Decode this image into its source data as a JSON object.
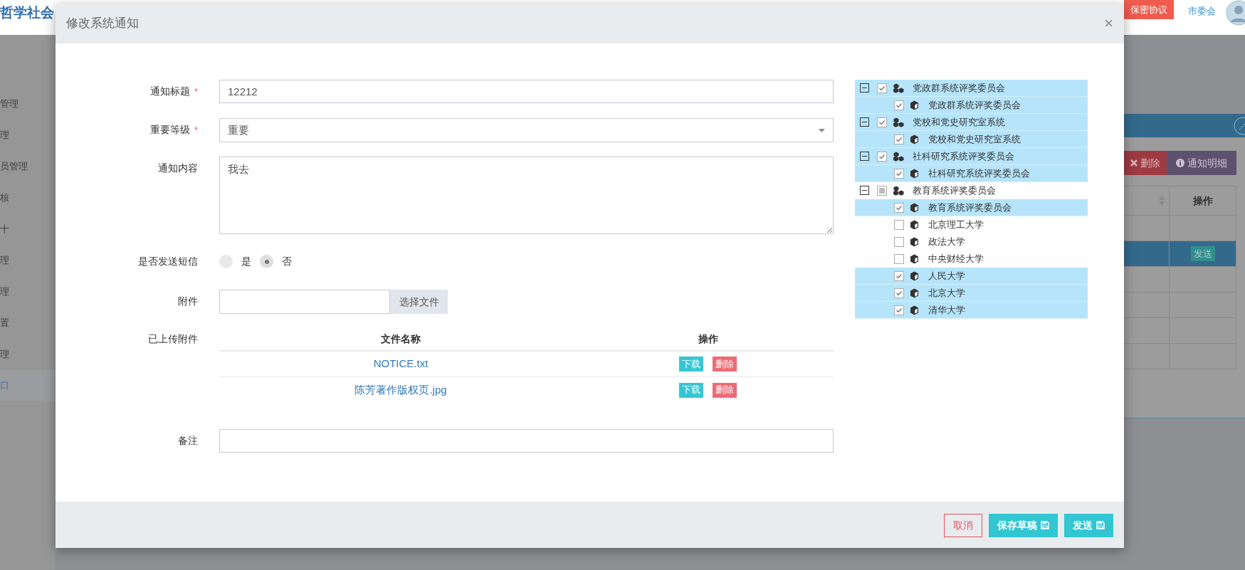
{
  "header": {
    "title": "哲学社会",
    "agreement_button": "保密协议",
    "user": "市委会"
  },
  "sidebar": {
    "items": [
      {
        "label": "管理",
        "selected": false
      },
      {
        "label": "理",
        "selected": false
      },
      {
        "label": "员管理",
        "selected": false
      },
      {
        "label": "核",
        "selected": false
      },
      {
        "label": "十",
        "selected": false
      },
      {
        "label": "理",
        "selected": false
      },
      {
        "label": "理",
        "selected": false
      },
      {
        "label": "置",
        "selected": false
      },
      {
        "label": "理",
        "selected": false
      },
      {
        "label": "口",
        "selected": true
      }
    ]
  },
  "background_panel": {
    "buttons": [
      {
        "kind": "delete",
        "label": "删除"
      },
      {
        "kind": "detail",
        "label": "通知明细"
      }
    ],
    "table": {
      "column_header": "操作",
      "rows": [
        {
          "selected": false
        },
        {
          "selected": true,
          "action": "发送"
        },
        {
          "selected": false
        },
        {
          "selected": false
        },
        {
          "selected": false
        },
        {
          "selected": false
        }
      ]
    }
  },
  "modal": {
    "title": "修改系统通知",
    "close": "×",
    "fields": [
      {
        "kind": "text",
        "label": "通知标题",
        "required_mark": "*",
        "value": "12212"
      },
      {
        "kind": "select",
        "label": "重要等级",
        "required_mark": "*",
        "value": "重要"
      },
      {
        "kind": "textarea",
        "label": "通知内容",
        "value": "我去"
      },
      {
        "kind": "radio",
        "label": "是否发送短信",
        "options": [
          {
            "label": "是",
            "selected": false
          },
          {
            "label": "否",
            "selected": true
          }
        ]
      },
      {
        "kind": "file",
        "label": "附件",
        "button": "选择文件"
      },
      {
        "kind": "files",
        "label": "已上传附件",
        "columns": [
          "文件名称",
          "操作"
        ],
        "rows": [
          {
            "name": "NOTICE.txt",
            "actions": [
              {
                "kind": "download",
                "label": "下载"
              },
              {
                "kind": "delete",
                "label": "删除"
              }
            ]
          },
          {
            "name": "陈芳著作版权页.jpg",
            "actions": [
              {
                "kind": "download",
                "label": "下载"
              },
              {
                "kind": "delete",
                "label": "删除"
              }
            ]
          }
        ]
      },
      {
        "kind": "text",
        "label": "备注"
      }
    ],
    "tree": {
      "nodes": [
        {
          "label": "党政群系统评奖委员会",
          "checked": true,
          "expanded": true,
          "children": [
            {
              "label": "党政群系统评奖委员会",
              "checked": true
            }
          ]
        },
        {
          "label": "党校和党史研究室系统",
          "checked": true,
          "expanded": true,
          "children": [
            {
              "label": "党校和党史研究室系统",
              "checked": true
            }
          ]
        },
        {
          "label": "社科研究系统评奖委员会",
          "checked": true,
          "expanded": true,
          "children": [
            {
              "label": "社科研究系统评奖委员会",
              "checked": true
            }
          ]
        },
        {
          "label": "教育系统评奖委员会",
          "checked": false,
          "partial": true,
          "expanded": true,
          "children": [
            {
              "label": "教育系统评奖委员会",
              "checked": true
            },
            {
              "label": "北京理工大学",
              "checked": false
            },
            {
              "label": "政法大学",
              "checked": false
            },
            {
              "label": "中央财经大学",
              "checked": false
            },
            {
              "label": "人民大学",
              "checked": true
            },
            {
              "label": "北京大学",
              "checked": true
            },
            {
              "label": "清华大学",
              "checked": true
            }
          ]
        }
      ]
    },
    "footer_buttons": [
      {
        "kind": "cancel",
        "label": "取消"
      },
      {
        "kind": "save",
        "label": "保存草稿"
      },
      {
        "kind": "save",
        "label": "发送"
      }
    ]
  }
}
